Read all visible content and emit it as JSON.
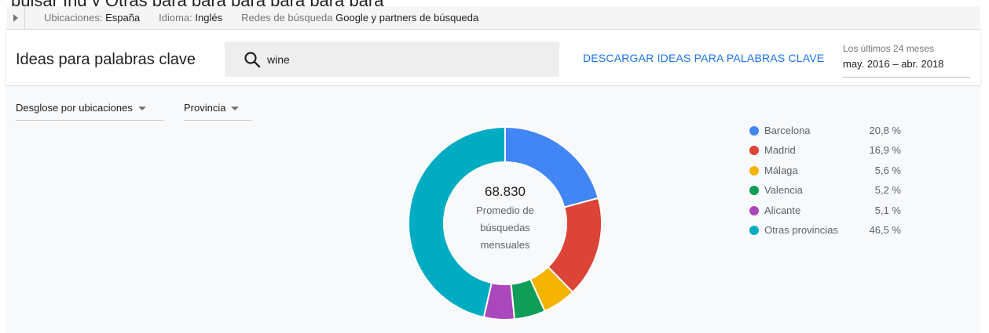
{
  "filters": {
    "location_key": "Ubicaciones:",
    "location_value": "España",
    "language_key": "Idioma:",
    "language_value": "Inglés",
    "network_key": "Redes de búsqueda",
    "network_value": "Google y partners de búsqueda"
  },
  "header": {
    "title": "Ideas para palabras clave",
    "search_value": "wine",
    "download_label": "DESCARGAR IDEAS PARA PALABRAS CLAVE",
    "range_label": "Los últimos 24 meses",
    "range_value": "may. 2016 – abr. 2018"
  },
  "controls": {
    "breakdown_label": "Desglose por ubicaciones",
    "level_label": "Provincia"
  },
  "chart_data": {
    "type": "pie",
    "center_value": "68.830",
    "center_label_lines": [
      "Promedio de",
      "búsquedas",
      "mensuales"
    ],
    "slices": [
      {
        "name": "Barcelona",
        "value": 20.8,
        "label": "20,8 %",
        "color": "#4285f4"
      },
      {
        "name": "Madrid",
        "value": 16.9,
        "label": "16,9 %",
        "color": "#db4437"
      },
      {
        "name": "Málaga",
        "value": 5.6,
        "label": "5,6 %",
        "color": "#f4b400"
      },
      {
        "name": "Valencia",
        "value": 5.2,
        "label": "5,2 %",
        "color": "#0f9d58"
      },
      {
        "name": "Alicante",
        "value": 5.1,
        "label": "5,1 %",
        "color": "#ab47bc"
      },
      {
        "name": "Otras provincias",
        "value": 46.5,
        "label": "46,5 %",
        "color": "#00acc1"
      }
    ]
  }
}
